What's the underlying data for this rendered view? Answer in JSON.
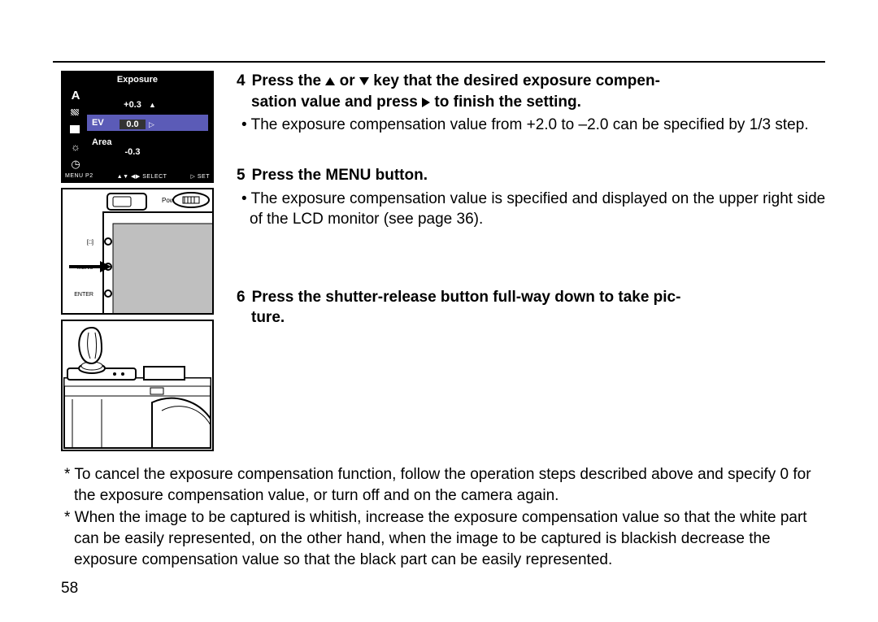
{
  "page_number": "58",
  "fig_lcd": {
    "title": "Exposure",
    "mode_letter": "A",
    "row_ev_label": "EV",
    "row_area_label": "Area",
    "val_plus": "+0.3",
    "val_zero": "0.0",
    "val_minus": "-0.3",
    "footer_left": "MENU P2",
    "footer_mid": "▲▼  ◀▶ SELECT",
    "footer_right": "▷ SET"
  },
  "fig_btn": {
    "label_power": "Power",
    "label_lcd": "[□]",
    "label_menu": "MENU",
    "label_enter": "ENTER"
  },
  "steps": {
    "s4_num": "4",
    "s4_a": "Press the ",
    "s4_b": " or ",
    "s4_c": " key that the desired exposure compen-",
    "s4_line2a": "sation value and press ",
    "s4_line2b": " to finish the setting.",
    "s4_bullet": "• The exposure compensation value from +2.0 to –2.0 can be specified by 1/3 step.",
    "s5_num": "5",
    "s5_head": "Press the MENU button.",
    "s5_bullet": "• The exposure compensation value is specified and displayed on the upper right side of the LCD monitor (see page 36).",
    "s6_num": "6",
    "s6_head": "Press the shutter-release button full-way down to take pic-",
    "s6_head2": "ture."
  },
  "notes": {
    "n1": "* To cancel the exposure compensation function, follow the operation steps described above and specify 0 for the exposure compensation value, or turn off and on the camera again.",
    "n2": "* When the image to be captured is whitish, increase the exposure compensation value so that the white part can be easily represented, on the other hand, when the image to be captured is blackish decrease the exposure compensation value so that the black part can be easily represented."
  }
}
